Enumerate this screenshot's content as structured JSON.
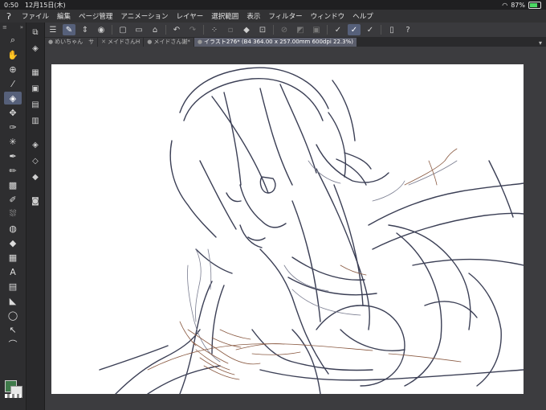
{
  "status": {
    "time": "0:50",
    "date": "12月15日(木)",
    "battery": "87%",
    "battery_level": 0.87,
    "wifi_icon": "wifi-icon"
  },
  "menu": [
    "ファイル",
    "編集",
    "ページ管理",
    "アニメーション",
    "レイヤー",
    "選択範囲",
    "表示",
    "フィルター",
    "ウィンドウ",
    "ヘルプ"
  ],
  "tabs": [
    {
      "label": "めいちゃん　サ",
      "close": "●"
    },
    {
      "label": "メイドさんH",
      "close": "✕"
    },
    {
      "label": "メイドさん謝*",
      "close": "●"
    },
    {
      "label": "イラスト276* (B4 364.00 x 257.00mm 600dpi 22.3%)",
      "close": "●"
    }
  ],
  "tab_overflow": "▾",
  "colors": {
    "main_color": "#3f7a4a",
    "sub_color": "#e8e8e8",
    "accent": "#56607a"
  }
}
